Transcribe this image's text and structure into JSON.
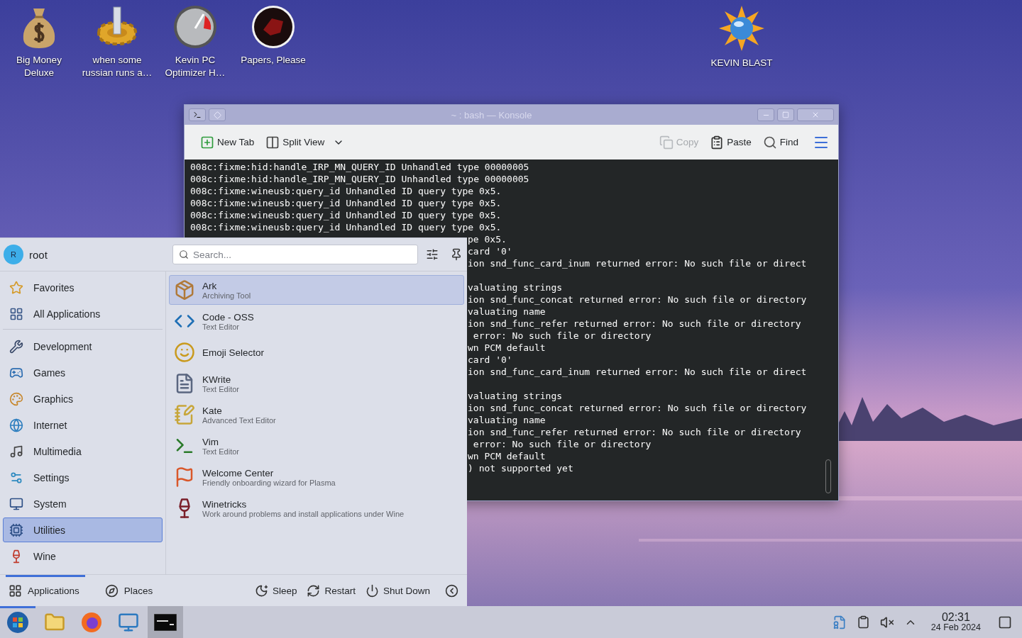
{
  "desktop_icons": [
    {
      "label": "Big Money Deluxe",
      "kind": "money"
    },
    {
      "label": "when some russian runs a…",
      "kind": "gear"
    },
    {
      "label": "Kevin PC Optimizer H…",
      "kind": "gauge"
    },
    {
      "label": "Papers, Please",
      "kind": "emblem"
    },
    {
      "label": "KEVIN BLAST",
      "kind": "sun"
    }
  ],
  "konsole": {
    "title": "~ : bash — Konsole",
    "toolbar": [
      {
        "label": "New Tab",
        "kind": "newtab",
        "disabled": false
      },
      {
        "label": "Split View",
        "kind": "split",
        "disabled": false
      },
      {
        "label": "Copy",
        "kind": "copy",
        "disabled": true
      },
      {
        "label": "Paste",
        "kind": "paste",
        "disabled": false
      },
      {
        "label": "Find",
        "kind": "find",
        "disabled": false
      }
    ],
    "lines": [
      {
        "kind": "full",
        "text": "008c:fixme:hid:handle_IRP_MN_QUERY_ID Unhandled type 00000005"
      },
      {
        "kind": "full",
        "text": "008c:fixme:hid:handle_IRP_MN_QUERY_ID Unhandled type 00000005"
      },
      {
        "kind": "full",
        "text": "008c:fixme:wineusb:query_id Unhandled ID query type 0x5."
      },
      {
        "kind": "full",
        "text": "008c:fixme:wineusb:query_id Unhandled ID query type 0x5."
      },
      {
        "kind": "full",
        "text": "008c:fixme:wineusb:query_id Unhandled ID query type 0x5."
      },
      {
        "kind": "full",
        "text": "008c:fixme:wineusb:query_id Unhandled ID query type 0x5."
      },
      {
        "kind": "tail",
        "text": "pe 0x5."
      },
      {
        "kind": "tail",
        "text": "card '0'"
      },
      {
        "kind": "tail",
        "text": "ion snd_func_card_inum returned error: No such file or direct"
      },
      {
        "kind": "blank"
      },
      {
        "kind": "tail",
        "text": "valuating strings"
      },
      {
        "kind": "tail",
        "text": "ion snd_func_concat returned error: No such file or directory"
      },
      {
        "kind": "tail",
        "text": "valuating name"
      },
      {
        "kind": "tail",
        "text": "ion snd_func_refer returned error: No such file or directory"
      },
      {
        "kind": "tail",
        "text": " error: No such file or directory"
      },
      {
        "kind": "tail",
        "text": "wn PCM default"
      },
      {
        "kind": "tail",
        "text": "card '0'"
      },
      {
        "kind": "tail",
        "text": "ion snd_func_card_inum returned error: No such file or direct"
      },
      {
        "kind": "blank"
      },
      {
        "kind": "tail",
        "text": "valuating strings"
      },
      {
        "kind": "tail",
        "text": "ion snd_func_concat returned error: No such file or directory"
      },
      {
        "kind": "tail",
        "text": "valuating name"
      },
      {
        "kind": "tail",
        "text": "ion snd_func_refer returned error: No such file or directory"
      },
      {
        "kind": "tail",
        "text": " error: No such file or directory"
      },
      {
        "kind": "tail",
        "text": "wn PCM default"
      },
      {
        "kind": "tail",
        "text": ") not supported yet"
      }
    ]
  },
  "launcher": {
    "user": {
      "initial": "R",
      "name": "root"
    },
    "search": {
      "placeholder": "Search..."
    },
    "categories_top": [
      {
        "label": "Favorites",
        "kind": "favorites",
        "selected": false
      },
      {
        "label": "All Applications",
        "kind": "all",
        "selected": false
      }
    ],
    "categories": [
      {
        "label": "Development",
        "kind": "development",
        "selected": false
      },
      {
        "label": "Games",
        "kind": "games",
        "selected": false
      },
      {
        "label": "Graphics",
        "kind": "graphics",
        "selected": false
      },
      {
        "label": "Internet",
        "kind": "internet",
        "selected": false
      },
      {
        "label": "Multimedia",
        "kind": "multimedia",
        "selected": false
      },
      {
        "label": "Settings",
        "kind": "settings",
        "selected": false
      },
      {
        "label": "System",
        "kind": "system",
        "selected": false
      },
      {
        "label": "Utilities",
        "kind": "utilities",
        "selected": true
      },
      {
        "label": "Wine",
        "kind": "wine",
        "selected": false
      }
    ],
    "apps": [
      {
        "name": "Ark",
        "description": "Archiving Tool",
        "kind": "ark",
        "selected": true
      },
      {
        "name": "Code - OSS",
        "description": "Text Editor",
        "kind": "code",
        "selected": false
      },
      {
        "name": "Emoji Selector",
        "kind": "emoji",
        "selected": false
      },
      {
        "name": "KWrite",
        "description": "Text Editor",
        "kind": "kwrite",
        "selected": false
      },
      {
        "name": "Kate",
        "description": "Advanced Text Editor",
        "kind": "kate",
        "selected": false
      },
      {
        "name": "Vim",
        "description": "Text Editor",
        "kind": "vim",
        "selected": false
      },
      {
        "name": "Welcome Center",
        "description": "Friendly onboarding wizard for Plasma",
        "kind": "welcome",
        "selected": false
      },
      {
        "name": "Winetricks",
        "description": "Work around problems and install applications under Wine",
        "kind": "winetricks",
        "selected": false
      }
    ],
    "footer_tabs": [
      {
        "label": "Applications",
        "kind": "applications",
        "selected": true
      },
      {
        "label": "Places",
        "kind": "places",
        "selected": false
      }
    ],
    "power": [
      {
        "label": "Sleep",
        "kind": "sleep"
      },
      {
        "label": "Restart",
        "kind": "restart"
      },
      {
        "label": "Shut Down",
        "kind": "shutdown"
      }
    ]
  },
  "taskbar": {
    "apps": [
      {
        "kind": "launcher",
        "active": true
      },
      {
        "kind": "files",
        "active": false
      },
      {
        "kind": "browser",
        "active": false
      },
      {
        "kind": "settings",
        "active": false
      },
      {
        "kind": "terminal",
        "active": true
      }
    ],
    "clock": {
      "time": "02:31",
      "date": "24 Feb 2024"
    }
  }
}
